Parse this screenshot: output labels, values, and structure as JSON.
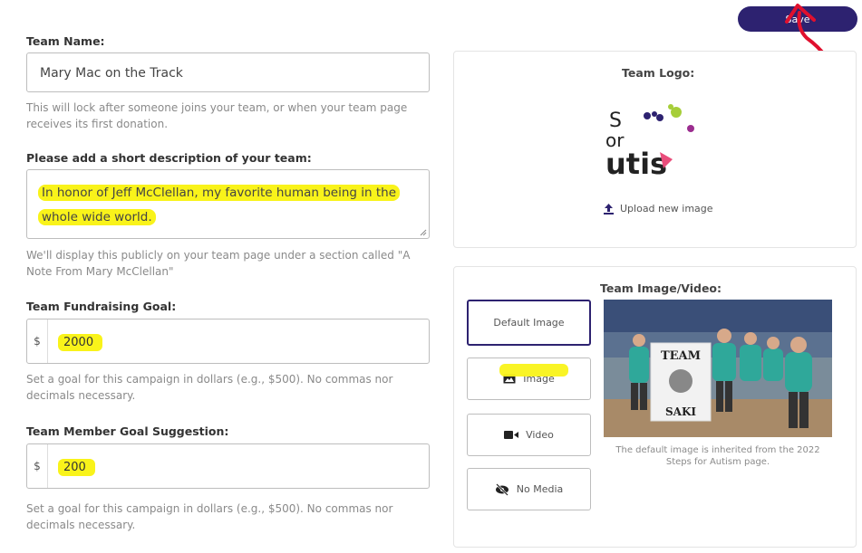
{
  "toolbar": {
    "save_label": "Save"
  },
  "team_name": {
    "label": "Team Name:",
    "value": "Mary Mac on the Track",
    "help": "This will lock after someone joins your team, or when your team page receives its first donation."
  },
  "description": {
    "label": "Please add a short description of your team:",
    "line1": "In honor of Jeff McClellan, my favorite human being in the",
    "line2": "whole wide world.",
    "help": "We'll display this publicly on your team page under a section called \"A Note From Mary McClellan\""
  },
  "fundraising_goal": {
    "label": "Team Fundraising Goal:",
    "currency": "$",
    "value": "2000",
    "help": "Set a goal for this campaign in dollars (e.g., $500). No commas nor decimals necessary."
  },
  "member_goal": {
    "label": "Team Member Goal Suggestion:",
    "currency": "$",
    "value": "200",
    "help": "Set a goal for this campaign in dollars (e.g., $500). No commas nor decimals necessary."
  },
  "logo": {
    "title": "Team Logo:",
    "upload_label": "Upload new image",
    "logo_text": {
      "top": "S",
      "middle": "or",
      "bottom": "utis"
    }
  },
  "media": {
    "title": "Team Image/Video:",
    "options": [
      {
        "label": "Default Image",
        "selected": true
      },
      {
        "label": "Image",
        "icon": "image-icon"
      },
      {
        "label": "Video",
        "icon": "video-camera-icon"
      },
      {
        "label": "No Media",
        "icon": "eye-slash-icon"
      }
    ],
    "photo_sign_top": "TEAM",
    "photo_sign_bottom": "SAKI",
    "caption": "The default image is inherited from the 2022 Steps for Autism page."
  },
  "colors": {
    "accent": "#2d2270",
    "highlight": "#f9f31a",
    "annotation_red": "#e0102e"
  }
}
